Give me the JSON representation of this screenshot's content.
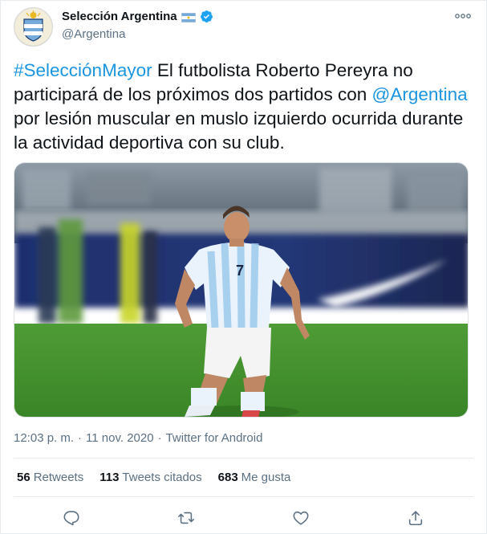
{
  "tweet": {
    "author_name": "Selección Argentina",
    "author_handle": "@Argentina",
    "text_parts": [
      {
        "text": "#SelecciónMayor",
        "link": true
      },
      {
        "text": " El futbolista Roberto Pereyra no participará de los próximos dos partidos con ",
        "link": false
      },
      {
        "text": "@Argentina",
        "link": true
      },
      {
        "text": " por lesión muscular en muslo izquierdo ocurrida durante la actividad deportiva con su club.",
        "link": false
      }
    ],
    "time": "12:03 p. m.",
    "separator": "·",
    "date": "11 nov. 2020",
    "separator2": "·",
    "source": "Twitter for Android"
  },
  "stats": {
    "retweets_count": "56",
    "retweets_label": "Retweets",
    "quotes_count": "113",
    "quotes_label": "Tweets citados",
    "likes_count": "683",
    "likes_label": "Me gusta"
  },
  "icons": {
    "verified": "verified-badge-icon",
    "flag": "argentina-flag-icon",
    "more": "more-icon",
    "reply": "reply-icon",
    "retweet": "retweet-icon",
    "like": "heart-icon",
    "share": "share-icon"
  },
  "colors": {
    "link": "#1b95e0",
    "verified": "#1da1f2",
    "secondary_text": "#5b7083",
    "primary_text": "#0f1419",
    "divider": "#e6ecf0",
    "pitch_green": "#3f8f2d",
    "jersey_sky_blue": "#75aadb"
  }
}
